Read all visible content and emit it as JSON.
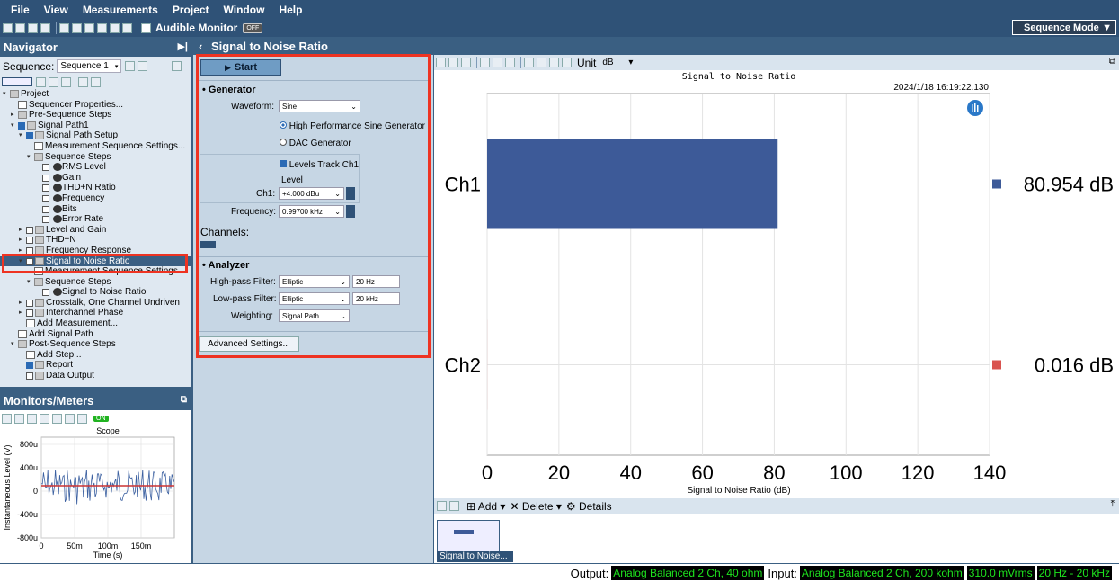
{
  "menu": [
    "File",
    "View",
    "Measurements",
    "Project",
    "Window",
    "Help"
  ],
  "toolbar": {
    "audible_label": "Audible Monitor",
    "audible_state": "OFF",
    "sequence_mode": "Sequence Mode"
  },
  "navigator": {
    "title": "Navigator",
    "sequence_label": "Sequence:",
    "sequence_value": "Sequence 1",
    "tree": [
      {
        "label": "Project",
        "indent": 0
      },
      {
        "label": "Sequencer Properties...",
        "indent": 1
      },
      {
        "label": "Pre-Sequence Steps",
        "indent": 1
      },
      {
        "label": "Signal Path1",
        "indent": 1
      },
      {
        "label": "Signal Path Setup",
        "indent": 2
      },
      {
        "label": "Measurement Sequence Settings...",
        "indent": 3
      },
      {
        "label": "Sequence Steps",
        "indent": 3
      },
      {
        "label": "RMS Level",
        "indent": 4
      },
      {
        "label": "Gain",
        "indent": 4
      },
      {
        "label": "THD+N Ratio",
        "indent": 4
      },
      {
        "label": "Frequency",
        "indent": 4
      },
      {
        "label": "Bits",
        "indent": 4
      },
      {
        "label": "Error Rate",
        "indent": 4
      },
      {
        "label": "Level and Gain",
        "indent": 2
      },
      {
        "label": "THD+N",
        "indent": 2
      },
      {
        "label": "Frequency Response",
        "indent": 2
      },
      {
        "label": "Signal to Noise Ratio",
        "indent": 2
      },
      {
        "label": "Measurement Sequence Settings...",
        "indent": 3
      },
      {
        "label": "Sequence Steps",
        "indent": 3
      },
      {
        "label": "Signal to Noise Ratio",
        "indent": 4
      },
      {
        "label": "Crosstalk, One Channel Undriven",
        "indent": 2
      },
      {
        "label": "Interchannel Phase",
        "indent": 2
      },
      {
        "label": "Add Measurement...",
        "indent": 2
      },
      {
        "label": "Add Signal Path",
        "indent": 1
      },
      {
        "label": "Post-Sequence Steps",
        "indent": 1
      },
      {
        "label": "Add Step...",
        "indent": 2
      },
      {
        "label": "Report",
        "indent": 2
      },
      {
        "label": "Data Output",
        "indent": 2
      }
    ]
  },
  "monitors": {
    "title": "Monitors/Meters",
    "state": "ON",
    "scope_title": "Scope",
    "ylabel": "Instantaneous Level (V)",
    "xlabel": "Time (s)",
    "yticks": [
      "800u",
      "400u",
      "0",
      "-400u",
      "-800u"
    ],
    "xticks": [
      "0",
      "50m",
      "100m",
      "150m"
    ]
  },
  "measurement": {
    "title": "Signal to Noise Ratio",
    "start_label": "Start",
    "generator_label": "Generator",
    "waveform_label": "Waveform:",
    "waveform_value": "Sine",
    "radio1": "High Performance Sine Generator",
    "radio2": "DAC Generator",
    "levels_track": "Levels Track Ch1",
    "level_label": "Level",
    "ch1_label": "Ch1:",
    "ch1_value": "+4.000 dBu",
    "freq_label": "Frequency:",
    "freq_value": "0.99700 kHz",
    "channels_label": "Channels:",
    "analyzer_label": "Analyzer",
    "hp_label": "High-pass Filter:",
    "hp_type": "Elliptic",
    "hp_value": "20 Hz",
    "lp_label": "Low-pass Filter:",
    "lp_type": "Elliptic",
    "lp_value": "20 kHz",
    "weighting_label": "Weighting:",
    "weighting_value": "Signal Path",
    "advanced_label": "Advanced Settings..."
  },
  "chart_toolbar": {
    "unit_label": "Unit",
    "unit_value": "dB"
  },
  "chart_data": {
    "type": "bar",
    "orientation": "horizontal",
    "title": "Signal to Noise Ratio",
    "timestamp": "2024/1/18 16:19:22.130",
    "categories": [
      "Ch1",
      "Ch2"
    ],
    "values": [
      80.954,
      0.016
    ],
    "value_labels": [
      "80.954 dB",
      "0.016 dB"
    ],
    "colors": [
      "#3d5a98",
      "#d9534f"
    ],
    "xlabel": "Signal to Noise Ratio (dB)",
    "xlim": [
      0,
      140
    ],
    "xticks": [
      "0",
      "20",
      "40",
      "60",
      "80",
      "100",
      "120",
      "140"
    ],
    "grid": true
  },
  "bottom_toolbar": {
    "add": "Add",
    "delete": "Delete",
    "details": "Details"
  },
  "thumbnail_label": "Signal to Noise...",
  "status": {
    "output_label": "Output:",
    "output_value": "Analog Balanced 2 Ch, 40 ohm",
    "input_label": "Input:",
    "input_value": "Analog Balanced 2 Ch, 200 kohm",
    "level": "310.0 mVrms",
    "range": "20 Hz - 20 kHz"
  }
}
